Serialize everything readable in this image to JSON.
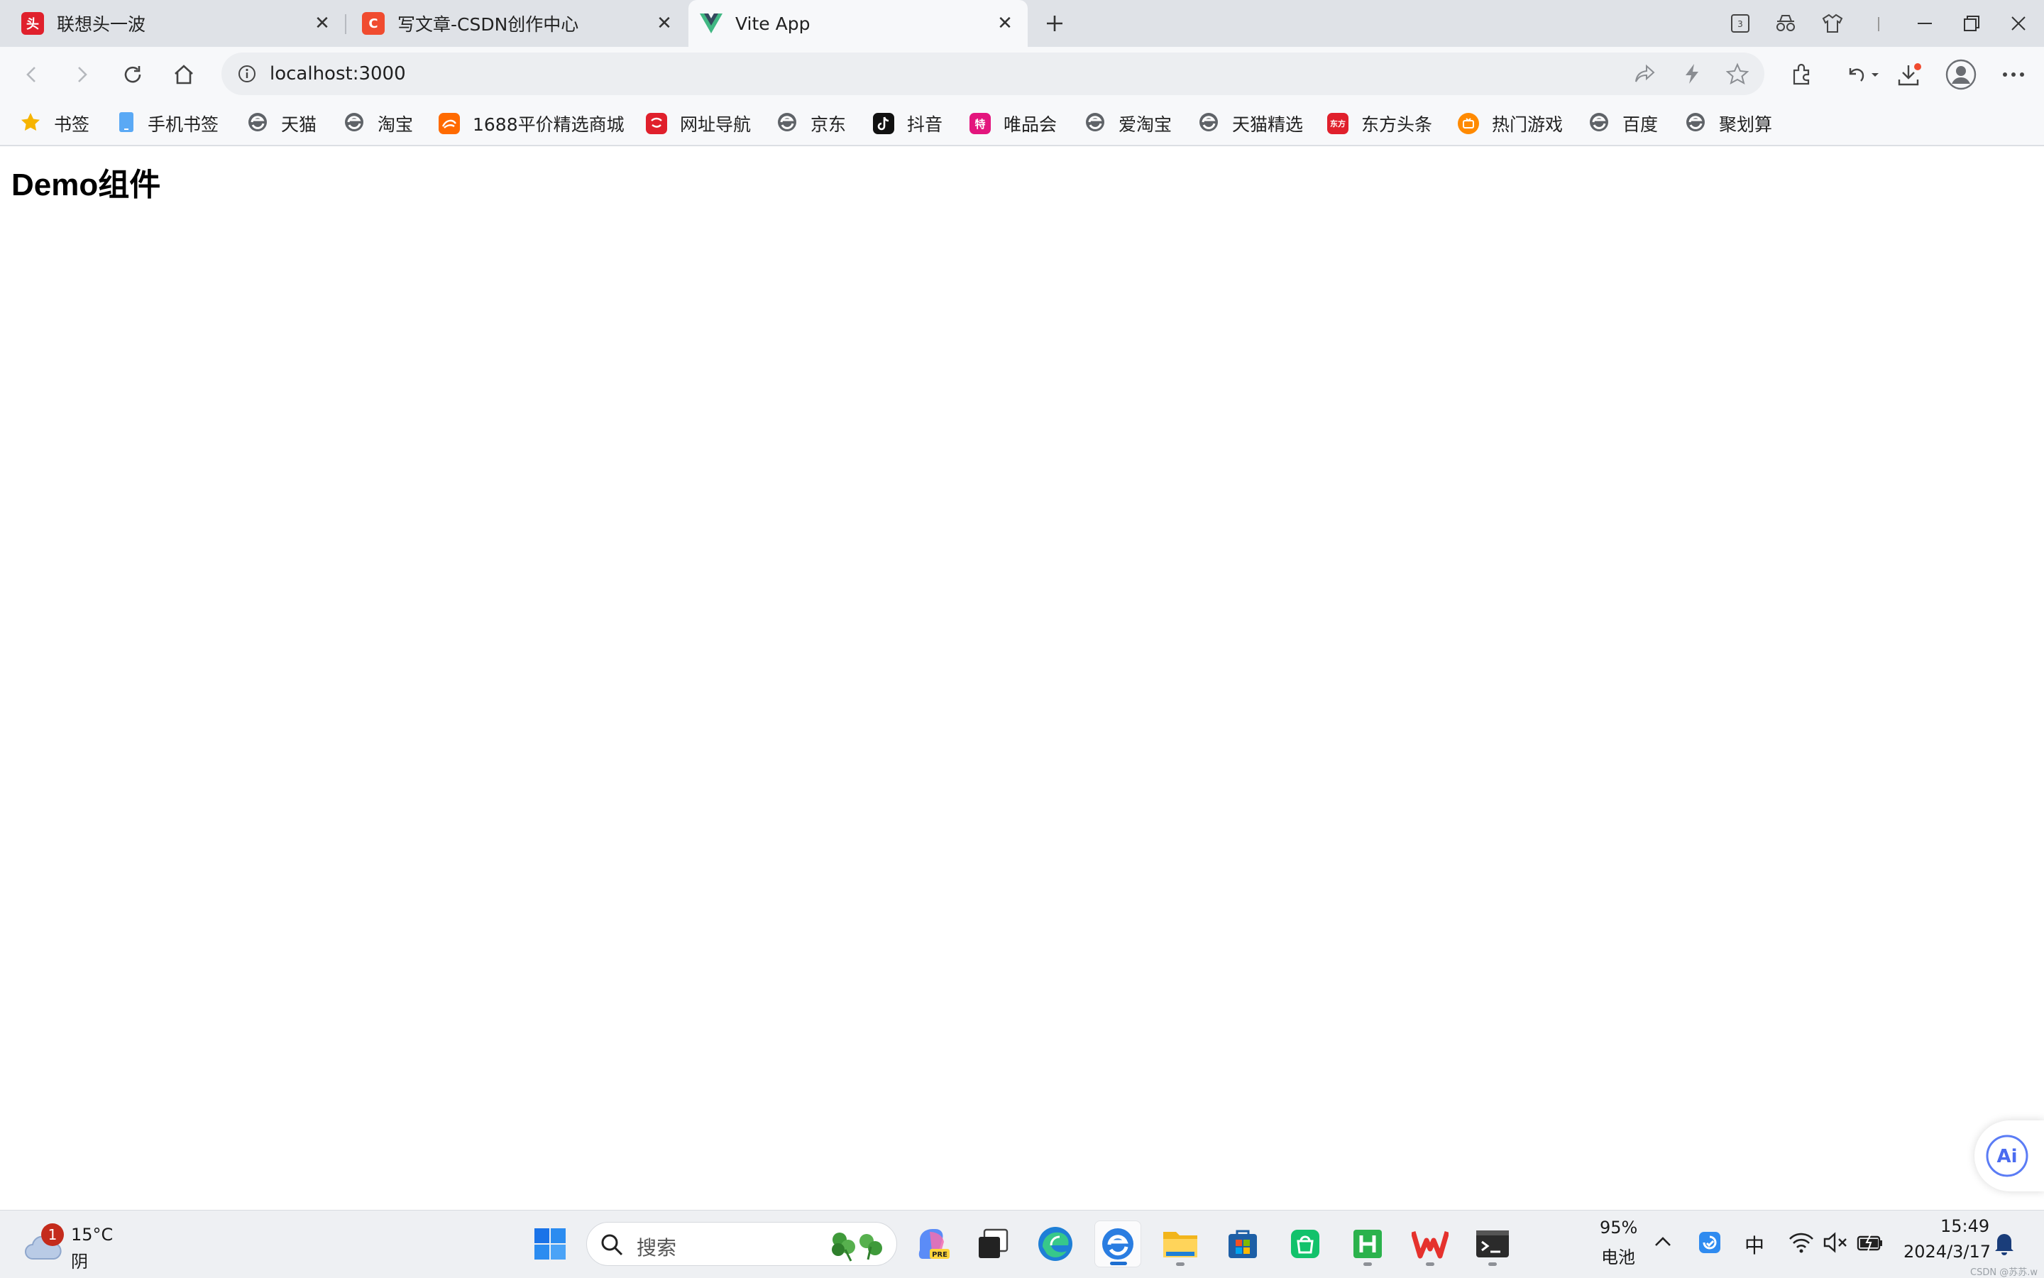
{
  "tabs": [
    {
      "title": "联想头一波",
      "favicon_text": "头"
    },
    {
      "title": "写文章-CSDN创作中心",
      "favicon_text": "C"
    },
    {
      "title": "Vite App",
      "favicon_text": ""
    }
  ],
  "tab_window_button": "3",
  "address_bar": {
    "url": "localhost:3000"
  },
  "bookmarks": [
    {
      "label": "书签",
      "icon": "star-icon"
    },
    {
      "label": "手机书签",
      "icon": "phone-icon"
    },
    {
      "label": "天猫",
      "icon": "globe-icon"
    },
    {
      "label": "淘宝",
      "icon": "globe-icon"
    },
    {
      "label": "1688平价精选商城",
      "icon": "1688-icon"
    },
    {
      "label": "网址导航",
      "icon": "nav-icon"
    },
    {
      "label": "京东",
      "icon": "globe-icon"
    },
    {
      "label": "抖音",
      "icon": "douyin-icon"
    },
    {
      "label": "唯品会",
      "icon": "vip-icon"
    },
    {
      "label": "爱淘宝",
      "icon": "globe-icon"
    },
    {
      "label": "天猫精选",
      "icon": "globe-icon"
    },
    {
      "label": "东方头条",
      "icon": "dongfang-icon"
    },
    {
      "label": "热门游戏",
      "icon": "game-icon"
    },
    {
      "label": "百度",
      "icon": "globe-icon"
    },
    {
      "label": "聚划算",
      "icon": "globe-icon"
    }
  ],
  "bookmark_icon_text": {
    "dongfang": "东方",
    "vip": "特"
  },
  "page": {
    "heading": "Demo组件"
  },
  "ai_button": "Ai",
  "taskbar": {
    "weather": {
      "temp": "15°C",
      "condition": "阴",
      "badge": "1"
    },
    "search_placeholder": "搜索",
    "battery": {
      "percent": "95%",
      "label": "电池"
    },
    "ime": "中",
    "time": "15:49",
    "date": "2024/3/17",
    "watermark": "CSDN @苏苏.w"
  }
}
